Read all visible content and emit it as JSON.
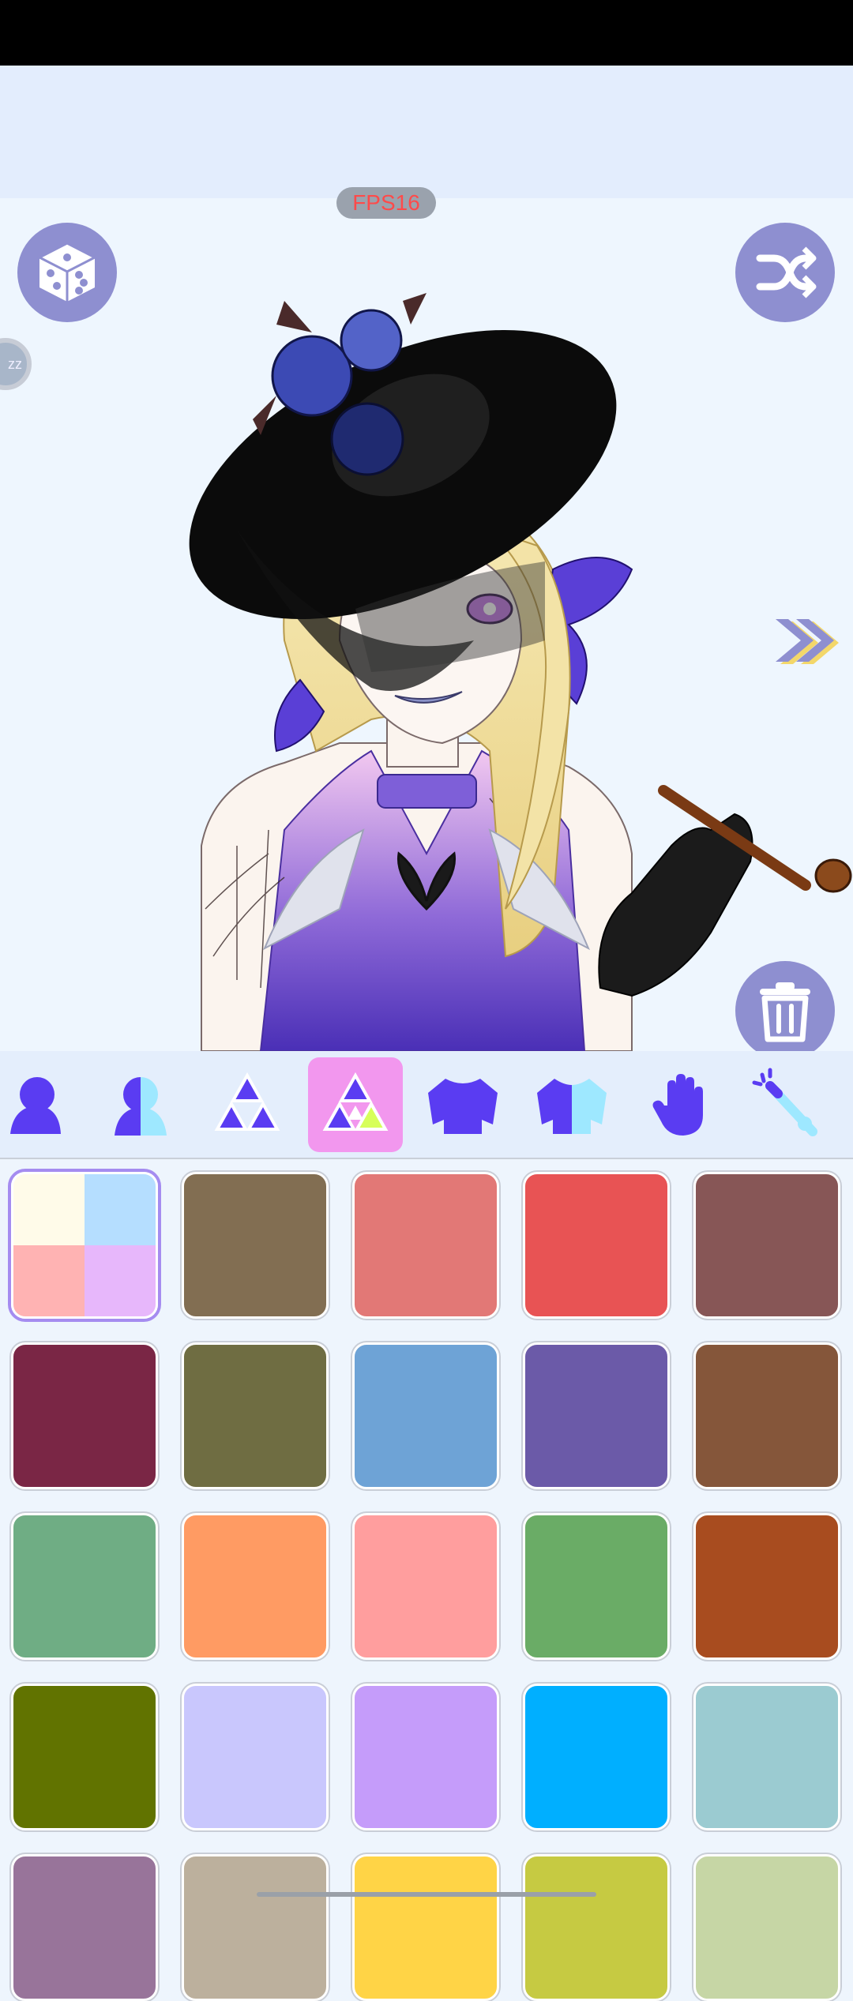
{
  "fps_label": "FPS16",
  "side_badge_text": "zz",
  "categories": [
    {
      "name": "body",
      "selected": false
    },
    {
      "name": "body-two-tone",
      "selected": false
    },
    {
      "name": "triforce",
      "selected": false
    },
    {
      "name": "triforce-color",
      "selected": true
    },
    {
      "name": "sweater",
      "selected": false
    },
    {
      "name": "sweater-two-tone",
      "selected": false
    },
    {
      "name": "hand",
      "selected": false
    },
    {
      "name": "magic-wand",
      "selected": false
    }
  ],
  "palette": {
    "first_multi": [
      "#fffbe9",
      "#b5deff",
      "#ffb3b3",
      "#e7b7fb"
    ],
    "colors": [
      "#826e52",
      "#e27876",
      "#e85354",
      "#875656",
      "#7a2645",
      "#6f6d42",
      "#6ea3d6",
      "#6b5aa8",
      "#85563a",
      "#6fad84",
      "#ff9b63",
      "#ff9e9e",
      "#6aac66",
      "#a84c1f",
      "#617300",
      "#c9c7fd",
      "#c59cfa",
      "#00afff",
      "#9bcbd1",
      "#98749a",
      "#bcb09d",
      "#ffd446",
      "#c6ca42",
      "#c6d6a5"
    ]
  }
}
